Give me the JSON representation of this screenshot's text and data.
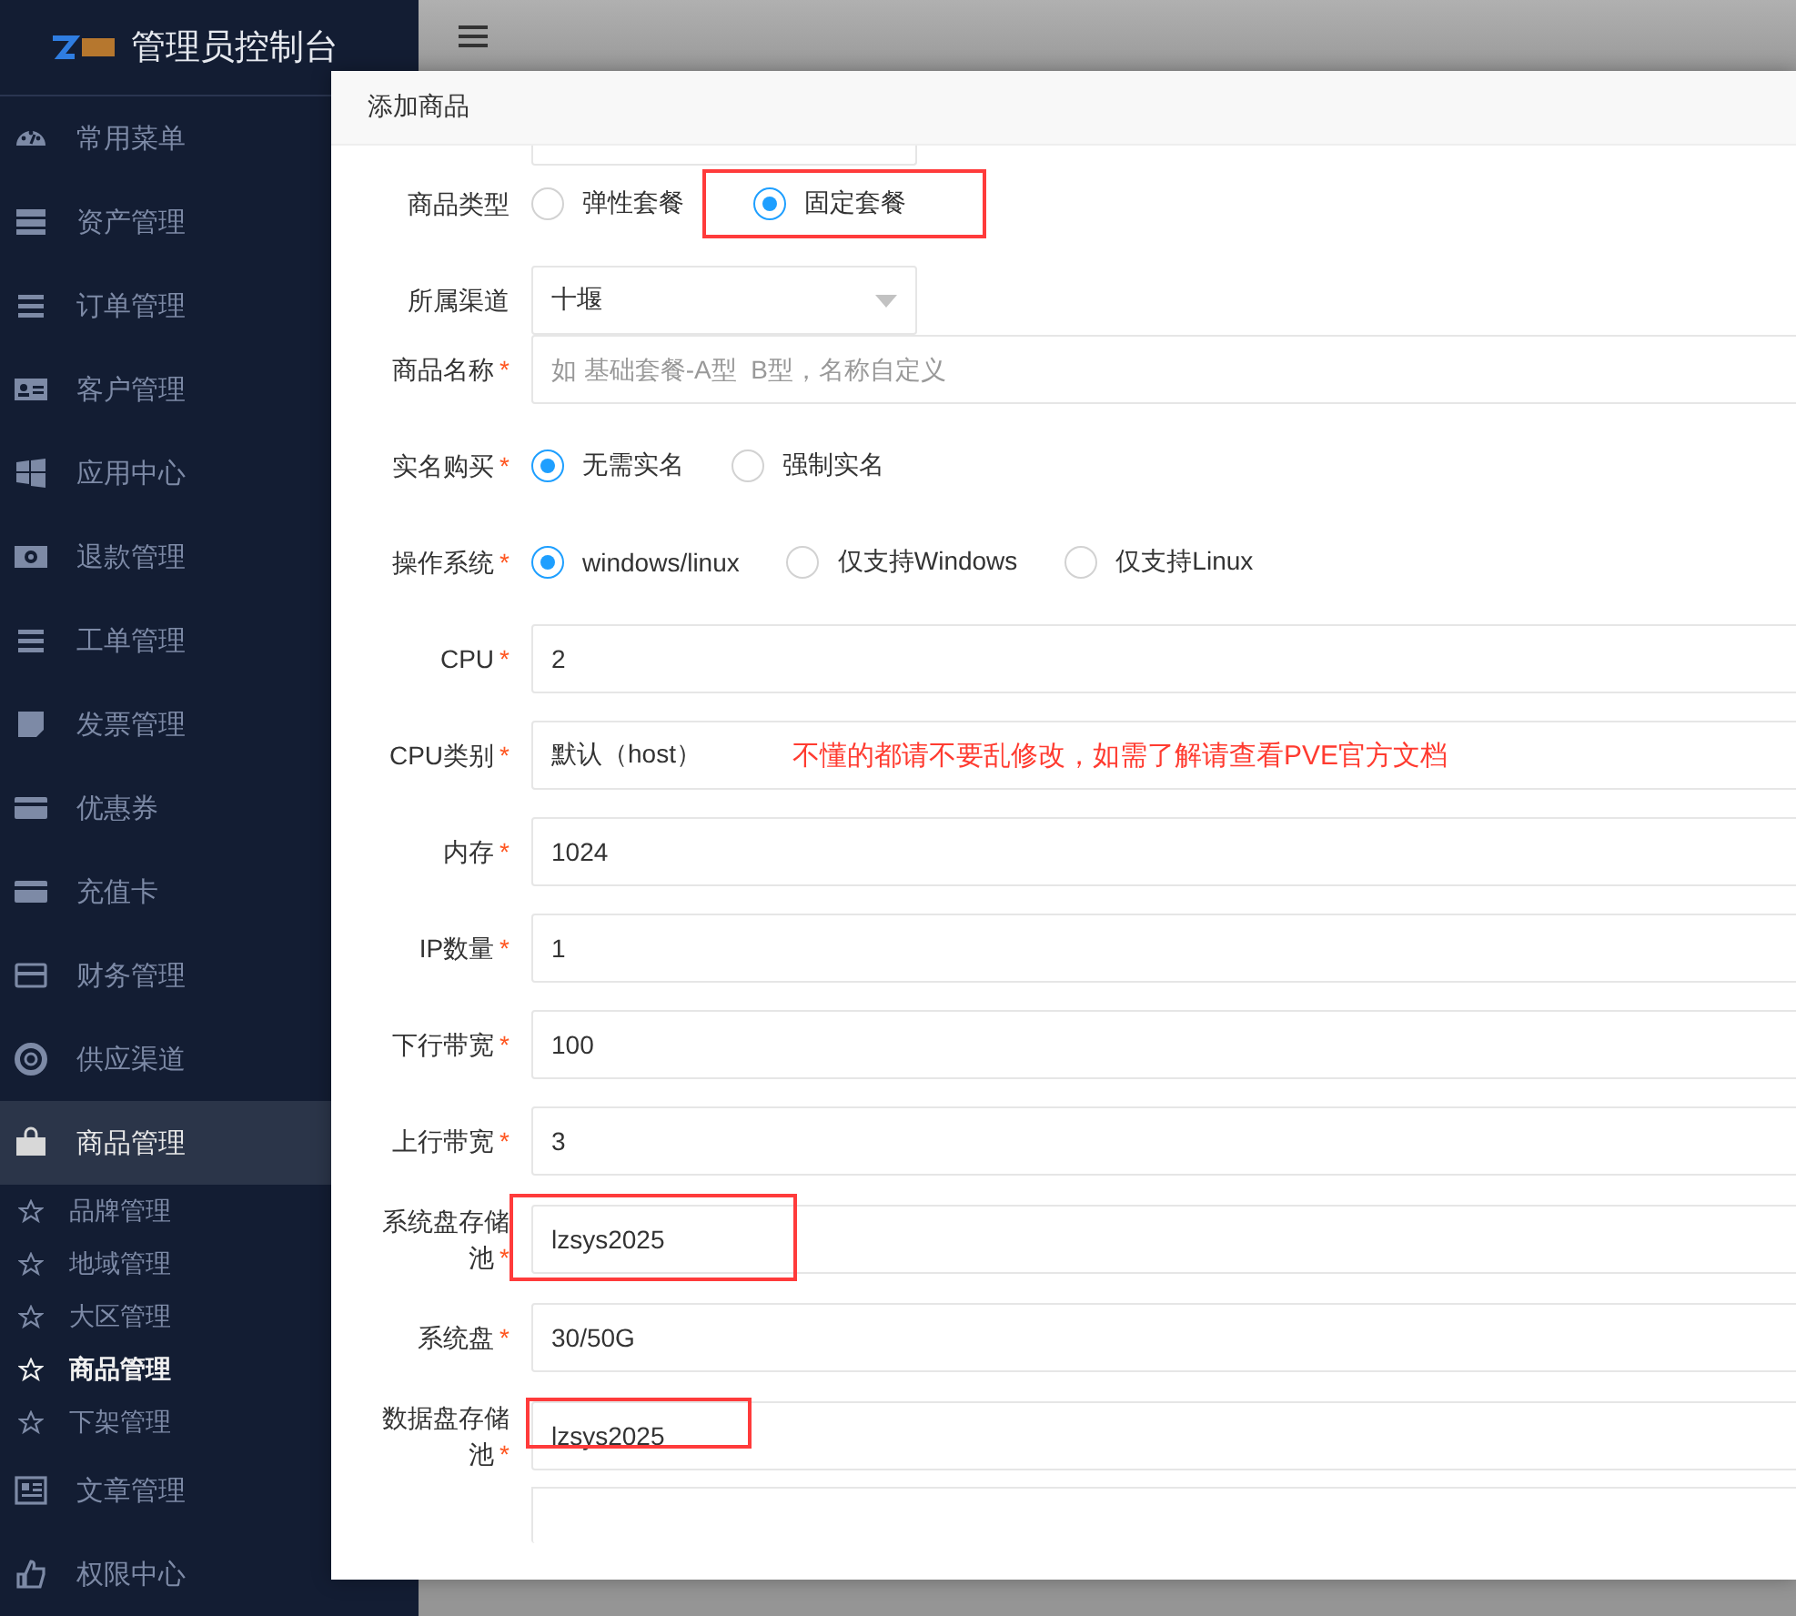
{
  "sidebar": {
    "title": "管理员控制台",
    "items": [
      {
        "label": "常用菜单",
        "selected": false
      },
      {
        "label": "资产管理",
        "selected": false
      },
      {
        "label": "订单管理",
        "selected": false
      },
      {
        "label": "客户管理",
        "selected": false
      },
      {
        "label": "应用中心",
        "selected": false
      },
      {
        "label": "退款管理",
        "selected": false
      },
      {
        "label": "工单管理",
        "selected": false
      },
      {
        "label": "发票管理",
        "selected": false
      },
      {
        "label": "优惠券",
        "selected": false
      },
      {
        "label": "充值卡",
        "selected": false
      },
      {
        "label": "财务管理",
        "selected": false
      },
      {
        "label": "供应渠道",
        "selected": false
      },
      {
        "label": "商品管理",
        "selected": true,
        "children": [
          {
            "label": "品牌管理",
            "selected": false
          },
          {
            "label": "地域管理",
            "selected": false
          },
          {
            "label": "大区管理",
            "selected": false
          },
          {
            "label": "商品管理",
            "selected": true
          },
          {
            "label": "下架管理",
            "selected": false
          }
        ]
      },
      {
        "label": "文章管理",
        "selected": false
      },
      {
        "label": "权限中心",
        "selected": false
      }
    ]
  },
  "dialog": {
    "title": "添加商品",
    "fields": [
      {
        "kind": "radio",
        "label": "商品类型",
        "options": [
          {
            "label": "弹性套餐",
            "selected": false,
            "annotated": false
          },
          {
            "label": "固定套餐",
            "selected": true,
            "annotated": true
          }
        ]
      },
      {
        "kind": "select",
        "label": "所属渠道",
        "value": "十堰"
      },
      {
        "kind": "text",
        "label": "商品名称",
        "required_mark": "*",
        "placeholder": "如 基础套餐-A型  B型，名称自定义"
      },
      {
        "kind": "radio",
        "label": "实名购买",
        "required_mark": "*",
        "options": [
          {
            "label": "无需实名",
            "selected": true,
            "annotated": false
          },
          {
            "label": "强制实名",
            "selected": false,
            "annotated": false
          }
        ]
      },
      {
        "kind": "radio",
        "label": "操作系统",
        "required_mark": "*",
        "options": [
          {
            "label": "windows/linux",
            "selected": true,
            "annotated": false
          },
          {
            "label": "仅支持Windows",
            "selected": false,
            "annotated": false
          },
          {
            "label": "仅支持Linux",
            "selected": false,
            "annotated": false
          }
        ]
      },
      {
        "kind": "text",
        "label": "CPU",
        "required_mark": "*",
        "value": "2"
      },
      {
        "kind": "text",
        "label": "CPU类别",
        "required_mark": "*",
        "value": "默认（host）",
        "note": "不懂的都请不要乱修改，如需了解请查看PVE官方文档"
      },
      {
        "kind": "text",
        "label": "内存",
        "required_mark": "*",
        "value": "1024"
      },
      {
        "kind": "text",
        "label": "IP数量",
        "required_mark": "*",
        "value": "1"
      },
      {
        "kind": "text",
        "label": "下行带宽",
        "required_mark": "*",
        "value": "100"
      },
      {
        "kind": "text",
        "label": "上行带宽",
        "required_mark": "*",
        "value": "3"
      },
      {
        "kind": "text",
        "label": "系统盘存储池",
        "required_mark": "*",
        "value": "lzsys2025",
        "annotated": true
      },
      {
        "kind": "text",
        "label": "系统盘",
        "required_mark": "*",
        "value": "30/50G"
      },
      {
        "kind": "text",
        "label": "数据盘存储池",
        "required_mark": "*",
        "value": "lzsys2025",
        "annotated": true
      }
    ]
  }
}
